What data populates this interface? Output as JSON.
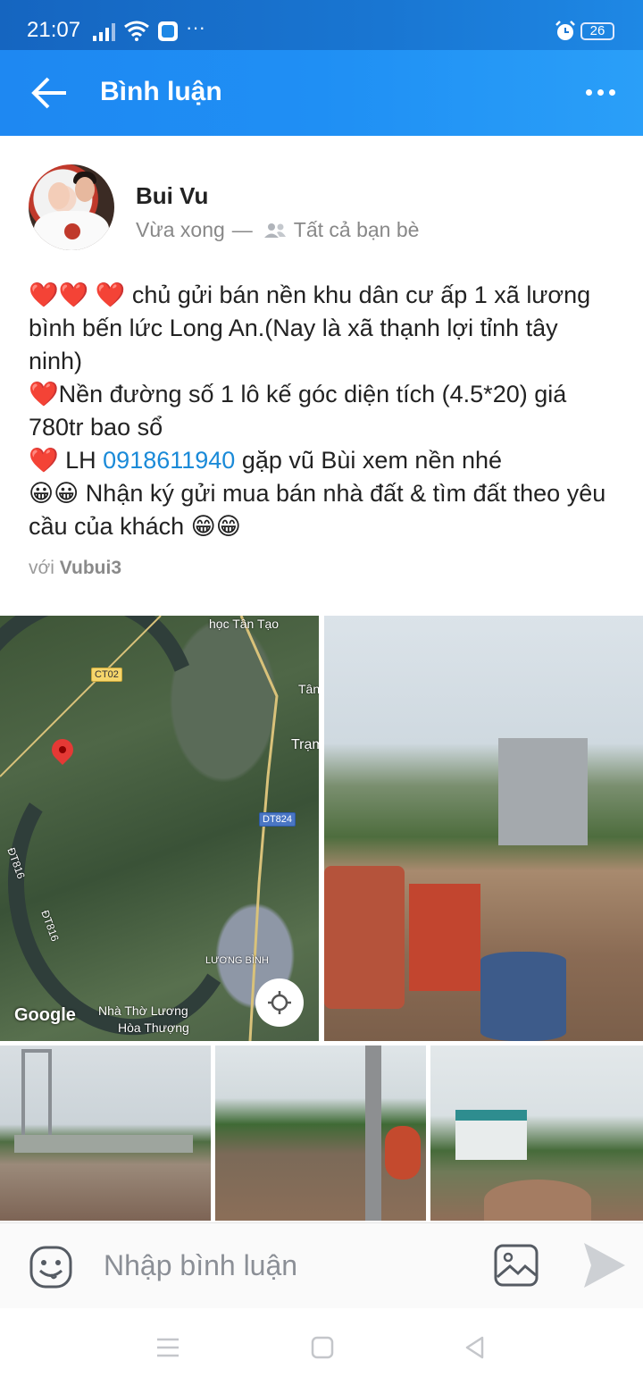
{
  "status_bar": {
    "time": "21:07",
    "dots": "···",
    "battery": "26"
  },
  "app_bar": {
    "title": "Bình luận",
    "back_icon": "arrow-left-icon",
    "menu_icon": "more-horizontal-icon"
  },
  "post": {
    "author": "Bui Vu",
    "time": "Vừa xong",
    "separator": "—",
    "privacy": "Tất cả bạn bè",
    "line1_hearts": "❤️❤️ ❤️",
    "line1_text": " chủ gửi bán nền khu dân cư ấp 1 xã lương bình bến lức Long An.(Nay là xã thạnh lợi tỉnh tây ninh)",
    "line2_heart": "❤️",
    "line2_text": "Nền đường số 1 lô kế góc diện tích (4.5*20) giá 780tr bao sổ",
    "line3_heart": "❤️",
    "line3_pre": " LH ",
    "phone": "0918611940",
    "line3_post": " gặp vũ Bùi xem nền nhé",
    "line4_emoji": "😀😀",
    "line4_text": " Nhận ký gửi mua bán nhà đất & tìm đất theo yêu cầu của khách ",
    "line4_end_emoji": "😁😁",
    "with_label": "với",
    "with_name": "Vubui3"
  },
  "map": {
    "labels": [
      "học Tân Tạo",
      "CT02",
      "Tân",
      "Trạm",
      "DT824",
      "ĐT816",
      "ĐT816",
      "LƯƠNG BÌNH",
      "Nhà Thờ Lương",
      "Hòa Thượng"
    ],
    "google": "Google"
  },
  "composer": {
    "placeholder": "Nhập bình luận"
  },
  "colors": {
    "accent": "#1e88f2",
    "link": "#1a8ad8",
    "heart": "#d9212b"
  }
}
